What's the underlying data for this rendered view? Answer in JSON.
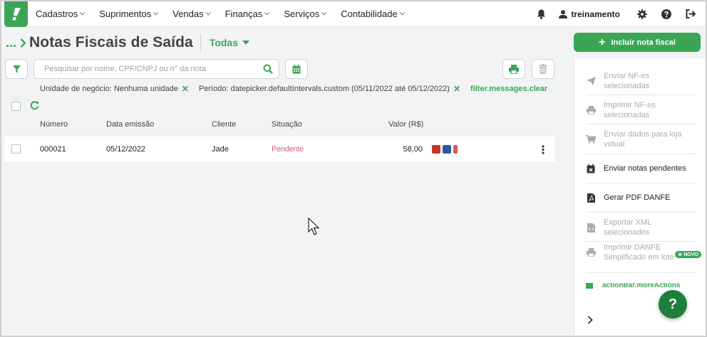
{
  "colors": {
    "brand": "#3aa655",
    "brand_dark": "#1d7f3e",
    "text": "#222222",
    "muted": "#a7acb0"
  },
  "nav": {
    "items": [
      {
        "label": "Cadastros"
      },
      {
        "label": "Suprimentos"
      },
      {
        "label": "Vendas"
      },
      {
        "label": "Finanças"
      },
      {
        "label": "Serviços"
      },
      {
        "label": "Contabilidade"
      }
    ],
    "user": "treinamento"
  },
  "header": {
    "breadcrumb": "...",
    "title": "Notas Fiscais de Saída",
    "filter_select": "Todas"
  },
  "search": {
    "placeholder": "Pesquisar por nome, CPF/CNPJ ou n° da nota"
  },
  "filters": {
    "items": [
      {
        "label": "Unidade de negócio: Nenhuma unidade"
      },
      {
        "label": "Período: datepicker.defaultIntervals.custom (05/11/2022 até 05/12/2022)"
      }
    ],
    "clear": "filter.messages.clear"
  },
  "table": {
    "columns": [
      "Número",
      "Data emissão",
      "Cliente",
      "Situação",
      "Valor (R$)"
    ],
    "rows": [
      {
        "numero": "000021",
        "data": "05/12/2022",
        "cliente": "Jade",
        "situacao": "Pendente",
        "valor": "58,00"
      }
    ]
  },
  "actions": {
    "primary": "Incluir nota fiscal",
    "items": [
      {
        "label": "Enviar NF-es selecionadas",
        "icon": "send-icon",
        "enabled": false
      },
      {
        "label": "Imprimir NF-es selecionadas",
        "icon": "printer-icon",
        "enabled": false
      },
      {
        "label": "Enviar dados para loja virtual",
        "icon": "cart-icon",
        "enabled": false
      },
      {
        "label": "Enviar notas pendentes",
        "icon": "calendar-x-icon",
        "enabled": true
      },
      {
        "label": "Gerar PDF DANFE",
        "icon": "pdf-icon",
        "enabled": true
      },
      {
        "label": "Exportar XML selecionados",
        "icon": "xml-file-icon",
        "enabled": false
      },
      {
        "label": "Imprimir DANFE Simplificado em lote",
        "icon": "printer-icon",
        "enabled": false,
        "badge": "★ NOVO"
      }
    ],
    "truncated_label": "actionBar.moreActions"
  },
  "help": "?"
}
